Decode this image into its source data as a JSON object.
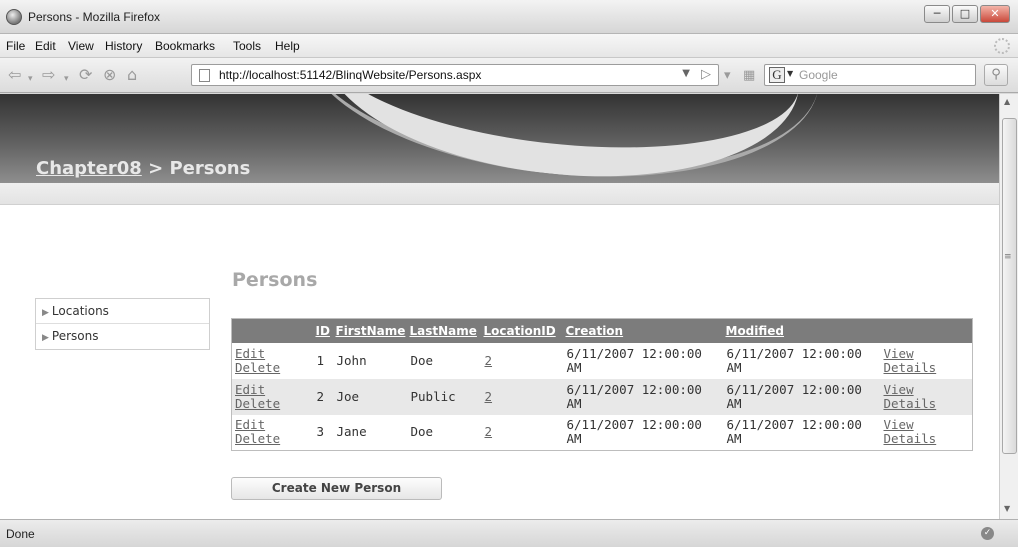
{
  "window": {
    "title": "Persons - Mozilla Firefox"
  },
  "menu": [
    "File",
    "Edit",
    "View",
    "History",
    "Bookmarks",
    "Tools",
    "Help"
  ],
  "nav": {
    "url": "http://localhost:51142/BlinqWebsite/Persons.aspx",
    "search_placeholder": "Google"
  },
  "breadcrumb": {
    "root": "Chapter08",
    "separator": ">",
    "current": "Persons"
  },
  "sidebar": {
    "items": [
      {
        "label": "Locations"
      },
      {
        "label": "Persons"
      }
    ]
  },
  "page": {
    "heading": "Persons",
    "create_button": "Create New Person"
  },
  "grid": {
    "columns": [
      "ID",
      "FirstName",
      "LastName",
      "LocationID",
      "Creation",
      "Modified"
    ],
    "edit_label": "Edit",
    "delete_label": "Delete",
    "view_label": "View Details",
    "rows": [
      {
        "id": "1",
        "first": "John",
        "last": "Doe",
        "location": "2",
        "creation": "6/11/2007 12:00:00 AM",
        "modified": "6/11/2007 12:00:00 AM"
      },
      {
        "id": "2",
        "first": "Joe",
        "last": "Public",
        "location": "2",
        "creation": "6/11/2007 12:00:00 AM",
        "modified": "6/11/2007 12:00:00 AM"
      },
      {
        "id": "3",
        "first": "Jane",
        "last": "Doe",
        "location": "2",
        "creation": "6/11/2007 12:00:00 AM",
        "modified": "6/11/2007 12:00:00 AM"
      }
    ]
  },
  "status": {
    "text": "Done"
  },
  "icons": [
    "firefox-icon",
    "back-icon",
    "forward-icon",
    "reload-icon",
    "stop-icon",
    "home-icon",
    "page-icon",
    "go-icon",
    "search-icon"
  ]
}
